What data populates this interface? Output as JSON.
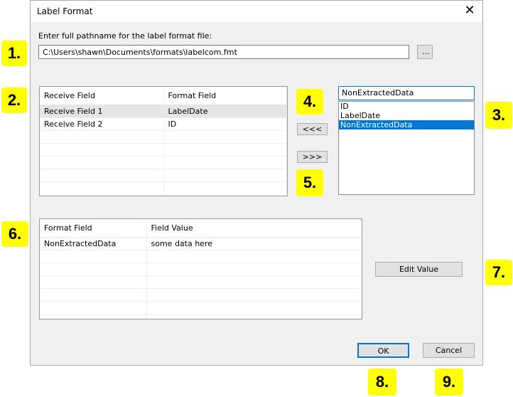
{
  "dialog": {
    "title": "Label Format",
    "close_glyph": "✕",
    "prompt": "Enter full pathname for the label format file:",
    "path_value": "C:\\Users\\shawn\\Documents\\formats\\labelcom.fmt",
    "browse_label": "..."
  },
  "receive_grid": {
    "headers": [
      "Receive Field",
      "Format Field"
    ],
    "rows": [
      [
        "Receive Field 1",
        "LabelDate"
      ],
      [
        "Receive Field 2",
        "ID"
      ],
      [
        "",
        ""
      ],
      [
        "",
        ""
      ],
      [
        "",
        ""
      ],
      [
        "",
        ""
      ],
      [
        "",
        ""
      ]
    ]
  },
  "buttons": {
    "move_left": "<<<",
    "move_right": ">>>",
    "edit_value": "Edit Value",
    "ok": "OK",
    "cancel": "Cancel"
  },
  "format_fields": {
    "selected": "NonExtractedData",
    "items": [
      "ID",
      "LabelDate",
      "NonExtractedData"
    ]
  },
  "value_grid": {
    "headers": [
      "Format Field",
      "Field Value"
    ],
    "rows": [
      [
        "NonExtractedData",
        "some data here"
      ],
      [
        "",
        ""
      ],
      [
        "",
        ""
      ],
      [
        "",
        ""
      ],
      [
        "",
        ""
      ],
      [
        "",
        ""
      ],
      [
        "",
        ""
      ]
    ]
  },
  "annotations": [
    "1.",
    "2.",
    "3.",
    "4.",
    "5.",
    "6.",
    "7.",
    "8.",
    "9."
  ],
  "colors": {
    "highlight": "#ffff00",
    "accent": "#0078d7",
    "dialog_bg": "#f0f0f0"
  }
}
